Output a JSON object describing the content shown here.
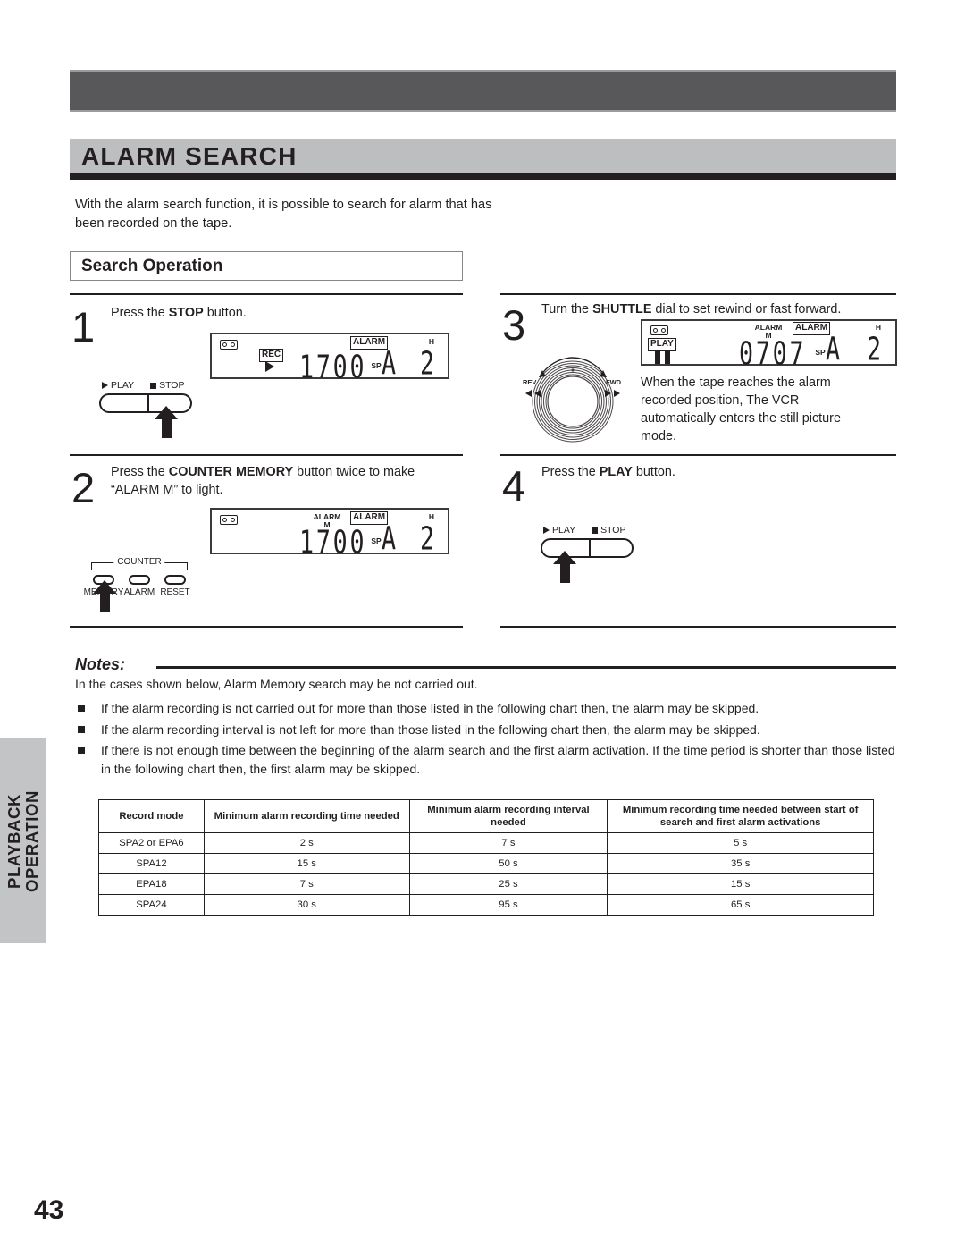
{
  "page": {
    "number": "43",
    "sidebar_tab": "PLAYBACK\nOPERATION",
    "sidebar_tab_line1": "PLAYBACK",
    "sidebar_tab_line2": "OPERATION"
  },
  "title": "ALARM SEARCH",
  "intro": "With the alarm search function, it is possible to search for alarm that has been recorded on the tape.",
  "section": {
    "heading": "Search Operation"
  },
  "steps": [
    {
      "number": "1",
      "text_before": "Press the ",
      "bold": "STOP",
      "text_after": " button.",
      "display": {
        "cassette_icon": "cassette-icon",
        "mode_box": "REC",
        "alarm_box": "ALARM",
        "alarm_m": "",
        "counter": "1700",
        "sp_label": "SP",
        "h_label": "H",
        "alarm_letter": "A",
        "alarm_number": "2"
      },
      "control": {
        "play_label": "PLAY",
        "stop_label": "STOP",
        "pressed": "stop"
      }
    },
    {
      "number": "2",
      "text_before": "Press the ",
      "bold": "COUNTER MEMORY",
      "text_after": " button twice to make “ALARM M” to light.",
      "display": {
        "cassette_icon": "cassette-icon",
        "mode_box": "",
        "alarm_box": "ALARM",
        "alarm_m_line1": "ALARM",
        "alarm_m_line2": "M",
        "counter": "1700",
        "sp_label": "SP",
        "h_label": "H",
        "alarm_letter": "A",
        "alarm_number": "2"
      },
      "counter_group": {
        "caption": "COUNTER",
        "buttons": [
          "MEMORY",
          "ALARM",
          "RESET"
        ],
        "pressed": "MEMORY"
      }
    },
    {
      "number": "3",
      "text_before": "Turn the ",
      "bold": "SHUTTLE",
      "text_after": " dial to set rewind or fast forward.",
      "note": "When the tape reaches the alarm recorded position, The VCR automatically enters the still picture mode.",
      "display": {
        "cassette_icon": "cassette-icon",
        "mode_box": "PLAY",
        "alarm_box": "ALARM",
        "alarm_m_line1": "ALARM",
        "alarm_m_line2": "M",
        "counter": "0707",
        "sp_label": "SP",
        "h_label": "H",
        "alarm_letter": "A",
        "alarm_number": "2"
      },
      "dial": {
        "rev_label": "REV",
        "fwd_label": "FWD"
      }
    },
    {
      "number": "4",
      "text_before": "Press the ",
      "bold": "PLAY",
      "text_after": " button.",
      "control": {
        "play_label": "PLAY",
        "stop_label": "STOP",
        "pressed": "play"
      }
    }
  ],
  "notes": {
    "heading": "Notes:",
    "intro": "In the cases shown below, Alarm Memory search may be not carried out.",
    "items": [
      "If the alarm recording is not carried out for more than those listed in the following chart then, the alarm may be skipped.",
      "If the alarm recording interval is not left for more than those listed in the following chart then, the alarm may be skipped.",
      "If there is not enough time between the beginning of the alarm search and the first alarm activation. If the time period is shorter than those listed in the following chart then, the first alarm may be skipped."
    ]
  },
  "table": {
    "headers": [
      "Record mode",
      "Minimum alarm recording time needed",
      "Minimum alarm recording interval needed",
      "Minimum recording time needed between start of search and first alarm activations"
    ],
    "rows": [
      [
        "SPA2 or EPA6",
        "2 s",
        "7 s",
        "5 s"
      ],
      [
        "SPA12",
        "15 s",
        "50 s",
        "35 s"
      ],
      [
        "EPA18",
        "7 s",
        "25 s",
        "15 s"
      ],
      [
        "SPA24",
        "30 s",
        "95 s",
        "65 s"
      ]
    ]
  },
  "colors": {
    "top_band": "#58585A",
    "title_band": "#BDBEC0",
    "sidebar_tab": "#C3C4C6",
    "ink": "#231F20"
  }
}
